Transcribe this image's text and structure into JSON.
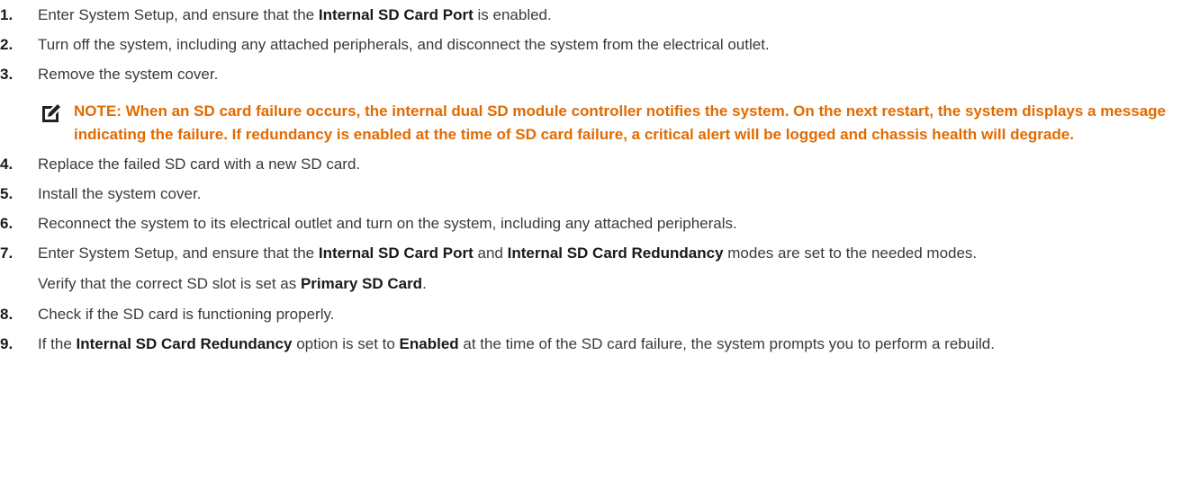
{
  "steps": [
    {
      "num": "1.",
      "a": "Enter System Setup, and ensure that the ",
      "b1": "Internal SD Card Port",
      "c": " is enabled."
    },
    {
      "num": "2.",
      "text": "Turn off the system, including any attached peripherals, and disconnect the system from the electrical outlet."
    },
    {
      "num": "3.",
      "text": "Remove the system cover."
    },
    {
      "num": "4.",
      "text": "Replace the failed SD card with a new SD card."
    },
    {
      "num": "5.",
      "text": "Install the system cover."
    },
    {
      "num": "6.",
      "text": "Reconnect the system to its electrical outlet and turn on the system, including any attached peripherals."
    },
    {
      "num": "7.",
      "a": "Enter System Setup, and ensure that the ",
      "b1": "Internal SD Card Port",
      "c": " and ",
      "b2": "Internal SD Card Redundancy",
      "d": " modes are set to the needed modes."
    },
    {
      "num": "8.",
      "text": "Check if the SD card is functioning properly."
    },
    {
      "num": "9.",
      "a": "If the ",
      "b1": "Internal SD Card Redundancy",
      "c": " option is set to ",
      "b2": "Enabled",
      "d": " at the time of the SD card failure, the system prompts you to perform a rebuild."
    }
  ],
  "note": {
    "icon": "note-pencil-icon",
    "text": "NOTE: When an SD card failure occurs, the internal dual SD module controller notifies the system. On the next restart, the system displays a message indicating the failure. If redundancy is enabled at the time of SD card failure, a critical alert will be logged and chassis health will degrade."
  },
  "step7_sub": {
    "a": "Verify that the correct SD slot is set as ",
    "b": "Primary SD Card",
    "c": "."
  },
  "colors": {
    "text": "#3a3a3a",
    "note": "#e26a00"
  }
}
